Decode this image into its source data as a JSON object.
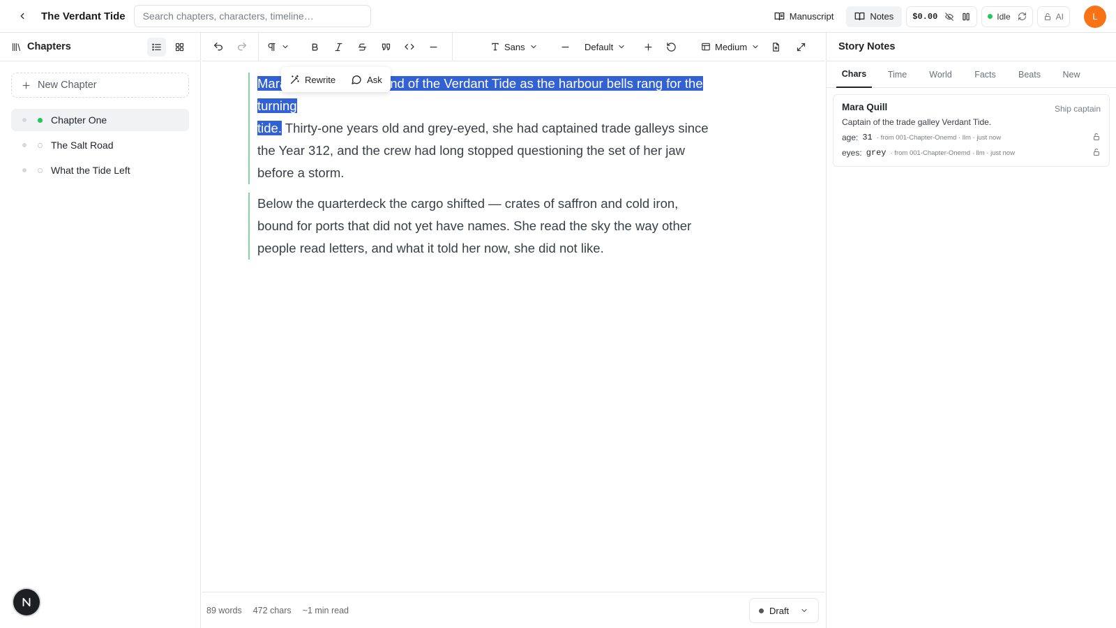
{
  "header": {
    "title": "The Verdant Tide",
    "search_placeholder": "Search chapters, characters, timeline…",
    "manuscript_label": "Manuscript",
    "notes_label": "Notes",
    "cost": "$0.00",
    "status": "Idle",
    "status_color": "#22c55e",
    "ai_label": "AI",
    "avatar_initial": "L",
    "avatar_color": "#f97316"
  },
  "sidebar": {
    "title": "Chapters",
    "new_chapter_label": "New Chapter",
    "chapters": [
      {
        "label": "Chapter One",
        "state": "done",
        "active": true
      },
      {
        "label": "The Salt Road",
        "state": "todo",
        "active": false
      },
      {
        "label": "What the Tide Left",
        "state": "todo",
        "active": false
      }
    ],
    "fab_label": "N"
  },
  "toolbar": {
    "font_label": "Sans",
    "size_label": "Default",
    "width_label": "Medium"
  },
  "floating_menu": {
    "rewrite_label": "Rewrite",
    "ask_label": "Ask"
  },
  "document": {
    "p1_selected_1": "Mara Quill took command of the Verdant Tide as the harbour bells rang for the turning ",
    "p1_selected_2": "tide.",
    "p1_rest": " Thirty-one years old and grey-eyed, she had captained trade galleys since the Year 312, and the crew had long stopped questioning the set of her jaw before a storm.",
    "p2": "Below the quarterdeck the cargo shifted — crates of saffron and cold iron, bound for ports that did not yet have names. She read the sky the way other people read letters, and what it told her now, she did not like."
  },
  "footer": {
    "words": "89 words",
    "chars": "472 chars",
    "read_time": "~1 min read",
    "status_label": "Draft"
  },
  "notes": {
    "title": "Story Notes",
    "tabs": [
      "Chars",
      "Time",
      "World",
      "Facts",
      "Beats",
      "New"
    ],
    "active_tab": "Chars",
    "card": {
      "name": "Mara Quill",
      "role": "Ship captain",
      "description": "Captain of the trade galley Verdant Tide.",
      "facts": [
        {
          "key": "age:",
          "value": "31",
          "meta": "· from 001-Chapter-Onemd · llm · just now"
        },
        {
          "key": "eyes:",
          "value": "grey",
          "meta": "· from 001-Chapter-Onemd · llm · just now"
        }
      ]
    }
  }
}
